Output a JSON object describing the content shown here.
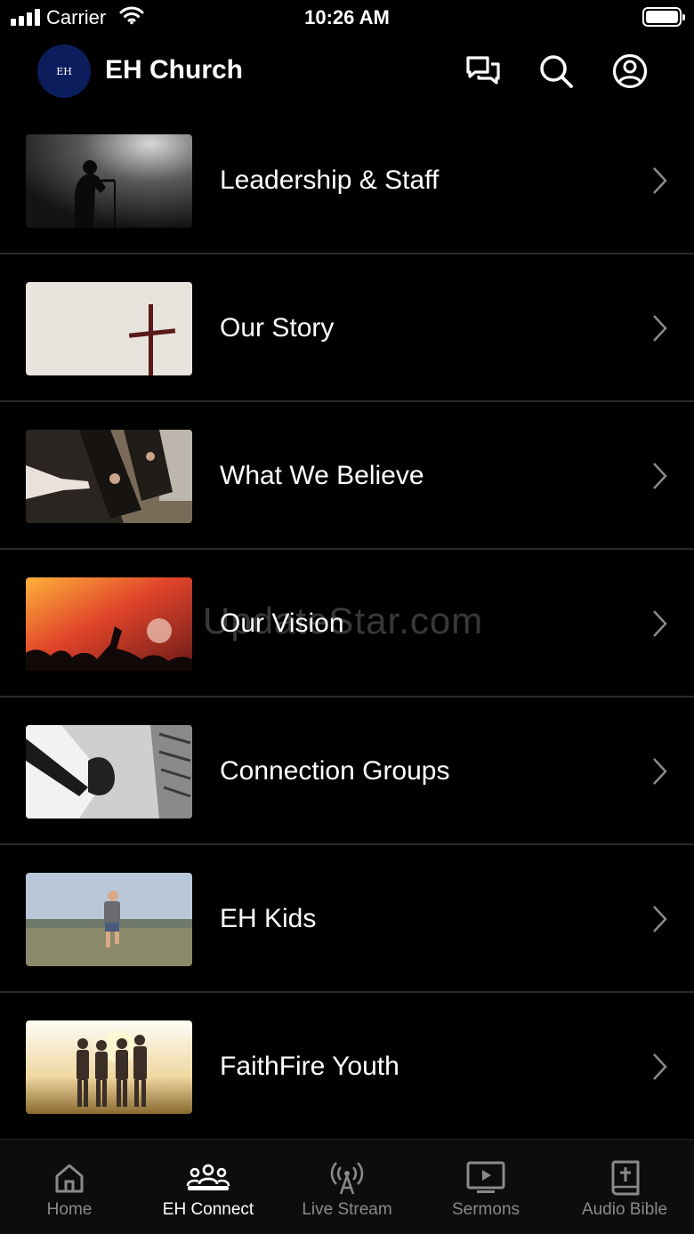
{
  "status_bar": {
    "carrier": "Carrier",
    "time": "10:26 AM"
  },
  "header": {
    "title": "EH Church",
    "logo_text": "EH",
    "icons": [
      "chat-icon",
      "search-icon",
      "profile-icon"
    ]
  },
  "menu_items": [
    {
      "label": "Leadership & Staff",
      "image": "singer-on-stage"
    },
    {
      "label": "Our Story",
      "image": "wooden-cross"
    },
    {
      "label": "What We Believe",
      "image": "worship-hands"
    },
    {
      "label": "Our Vision",
      "image": "concert-crowd"
    },
    {
      "label": "Connection Groups",
      "image": "holding-hands"
    },
    {
      "label": "EH Kids",
      "image": "child-running"
    },
    {
      "label": "FaithFire Youth",
      "image": "youth-group-sunset"
    }
  ],
  "watermark": "UpdateStar.com",
  "tabs": [
    {
      "label": "Home",
      "icon": "home-icon",
      "active": false
    },
    {
      "label": "EH Connect",
      "icon": "people-icon",
      "active": true
    },
    {
      "label": "Live Stream",
      "icon": "broadcast-icon",
      "active": false
    },
    {
      "label": "Sermons",
      "icon": "tv-play-icon",
      "active": false
    },
    {
      "label": "Audio Bible",
      "icon": "bible-icon",
      "active": false
    }
  ],
  "colors": {
    "background": "#000000",
    "divider": "#2a2a2a",
    "tab_inactive": "#8a8a8a",
    "tab_active": "#ffffff",
    "logo_bg": "#0c1d5e"
  }
}
